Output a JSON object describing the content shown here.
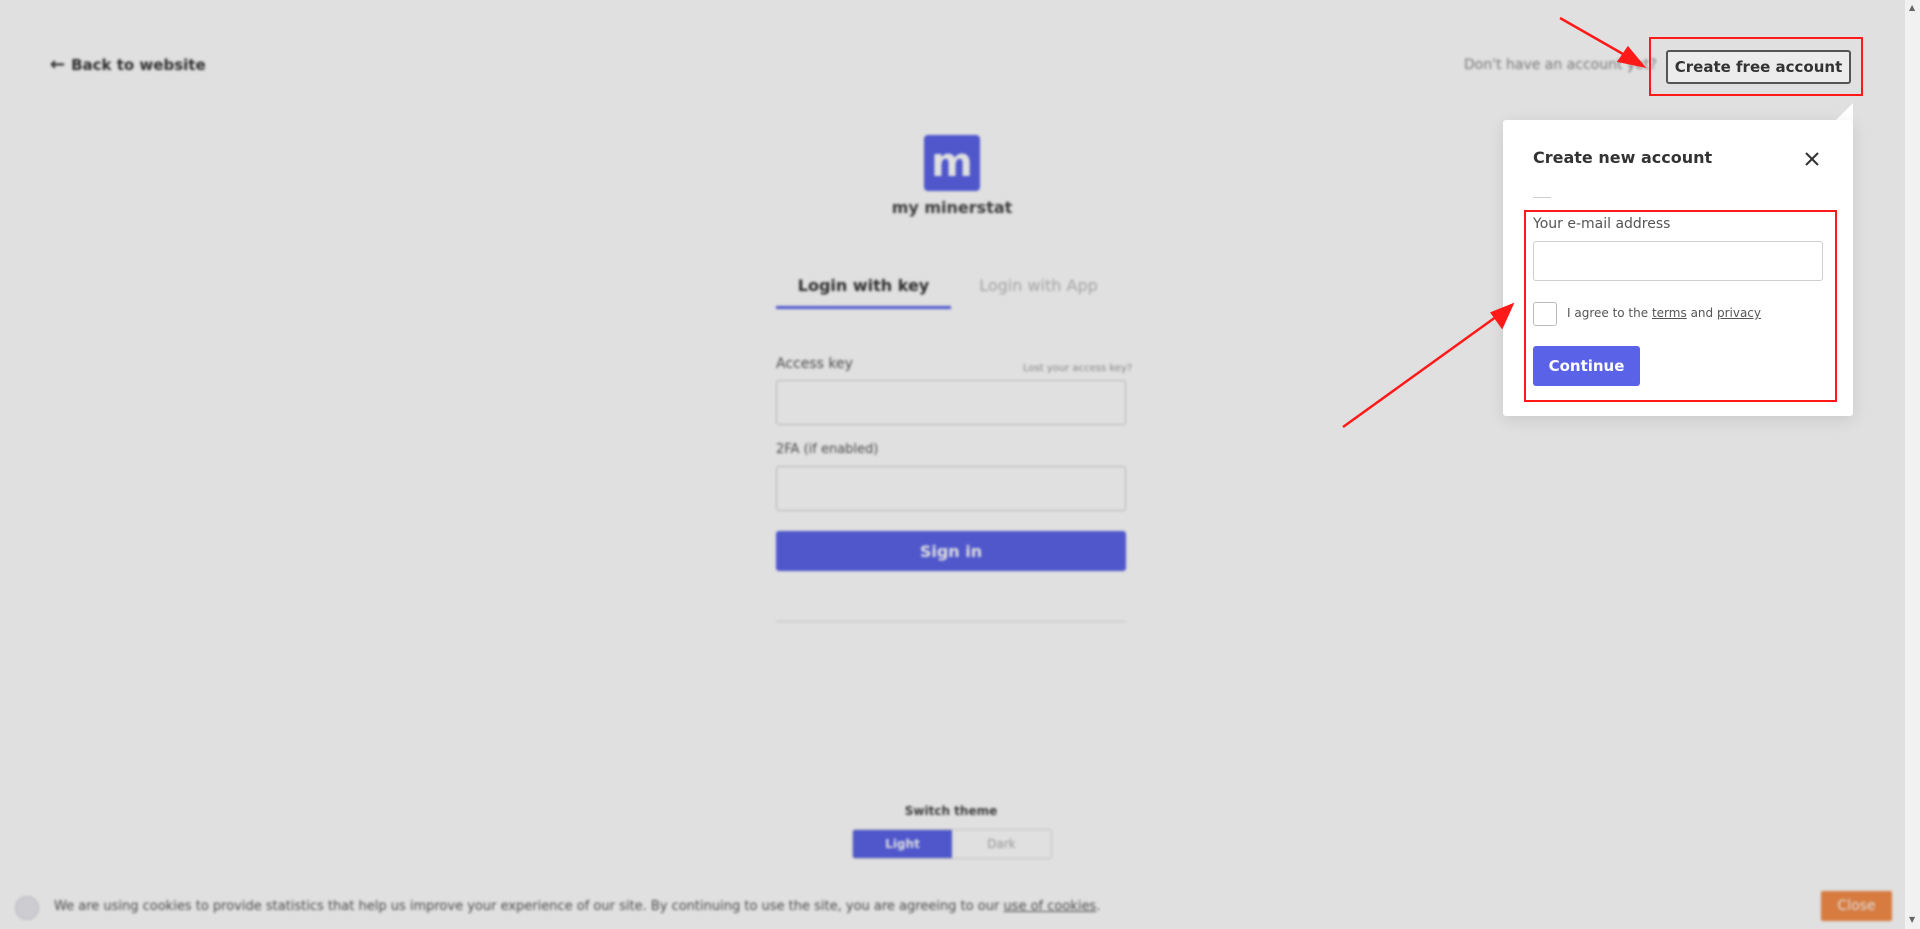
{
  "header": {
    "back_label": "Back to website",
    "no_account_text": "Don't have an account yet?",
    "create_account_label": "Create free account"
  },
  "logo": {
    "glyph": "m",
    "name": "my minerstat"
  },
  "login": {
    "tabs": [
      "Login with key",
      "Login with App"
    ],
    "access_key_label": "Access key",
    "lost_key_label": "Lost your access key?",
    "twofa_label": "2FA (if enabled)",
    "signin_label": "Sign in"
  },
  "theme": {
    "label": "Switch theme",
    "options": [
      "Light",
      "Dark"
    ]
  },
  "cookie": {
    "text": "We are using cookies to provide statistics that help us improve your experience of our site. By continuing to use the site, you are agreeing to our",
    "link": "use of cookies",
    "end": ".",
    "close_label": "Close"
  },
  "popover": {
    "title": "Create new account",
    "email_label": "Your e-mail address",
    "email_value": "",
    "agree_prefix": "I agree to the",
    "terms_link": "terms",
    "and_text": "and",
    "privacy_link": "privacy",
    "continue_label": "Continue"
  },
  "colors": {
    "accent": "#5a63e8",
    "annotation": "#ff1a1a",
    "cookie_close": "#f58d49"
  }
}
